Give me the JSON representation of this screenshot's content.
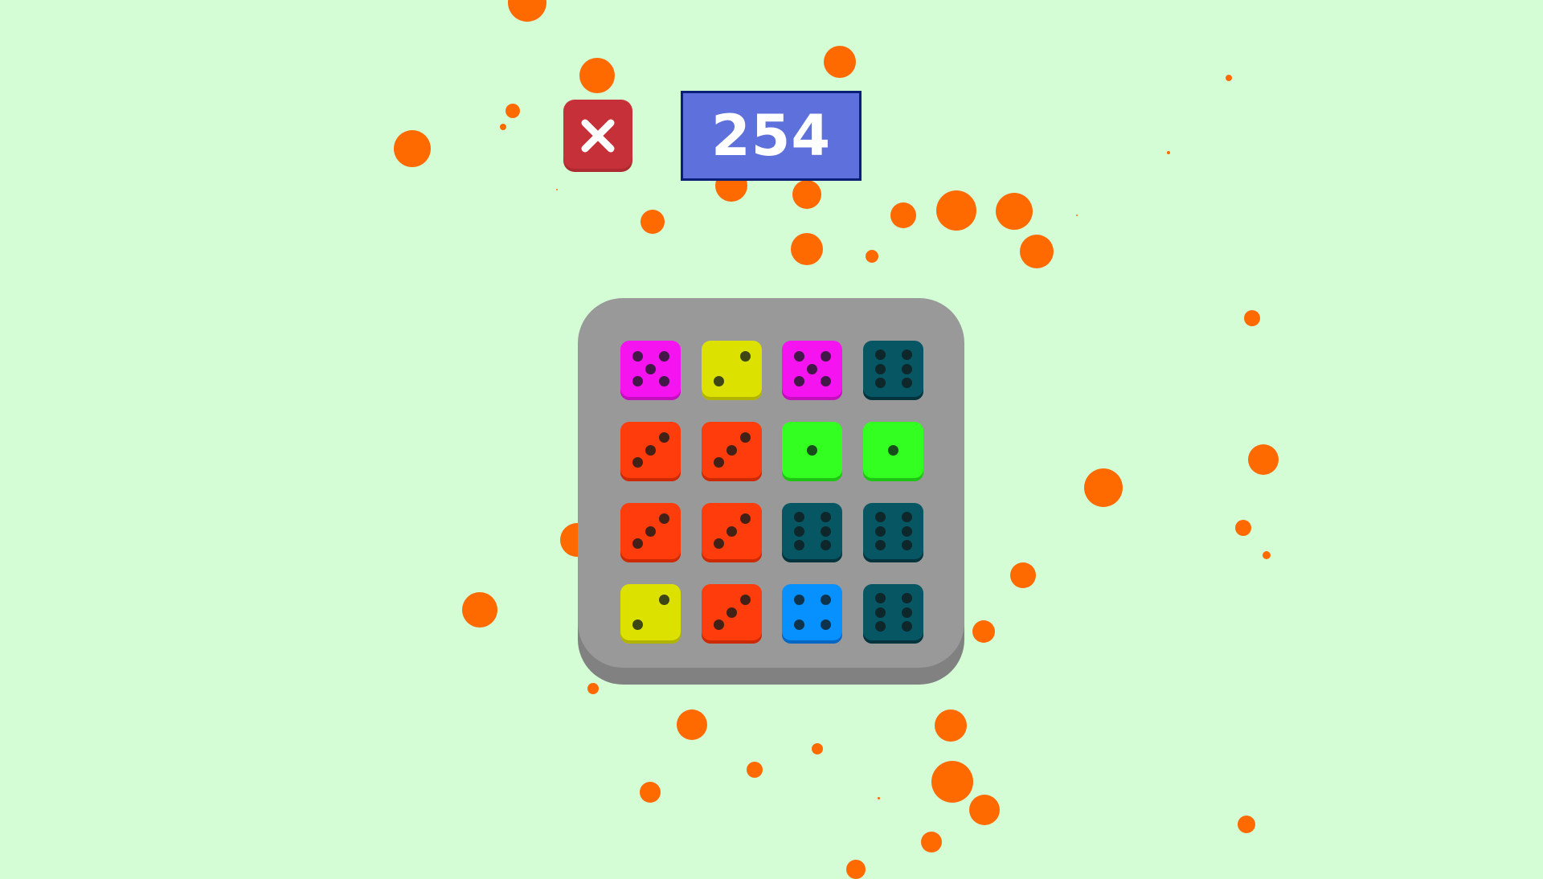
{
  "score": {
    "value": "254"
  },
  "close_button": {
    "icon": "close-icon"
  },
  "colors": {
    "background": "#d4fdd6",
    "particle": "#ff6a00",
    "board": "#999999",
    "board_shadow": "#818181",
    "score_bg": "#5d70dc",
    "score_border": "#0a1f78",
    "close_bg": "#c63038"
  },
  "board": {
    "rows": 4,
    "cols": 4,
    "dice": [
      {
        "value": 5,
        "color": "#f514ef",
        "shade": "#c40fbf"
      },
      {
        "value": 2,
        "color": "#dde100",
        "shade": "#b0b300"
      },
      {
        "value": 5,
        "color": "#f514ef",
        "shade": "#c40fbf"
      },
      {
        "value": 6,
        "color": "#075664",
        "shade": "#03343d"
      },
      {
        "value": 3,
        "color": "#ff3c0b",
        "shade": "#cc2a04"
      },
      {
        "value": 3,
        "color": "#ff3c0b",
        "shade": "#cc2a04"
      },
      {
        "value": 1,
        "color": "#33ff21",
        "shade": "#1fc313"
      },
      {
        "value": 1,
        "color": "#33ff21",
        "shade": "#1fc313"
      },
      {
        "value": 3,
        "color": "#ff3c0b",
        "shade": "#cc2a04"
      },
      {
        "value": 3,
        "color": "#ff3c0b",
        "shade": "#cc2a04"
      },
      {
        "value": 6,
        "color": "#075664",
        "shade": "#03343d"
      },
      {
        "value": 6,
        "color": "#075664",
        "shade": "#03343d"
      },
      {
        "value": 2,
        "color": "#dde100",
        "shade": "#b0b300"
      },
      {
        "value": 3,
        "color": "#ff3c0b",
        "shade": "#cc2a04"
      },
      {
        "value": 4,
        "color": "#0790ff",
        "shade": "#0567c4"
      },
      {
        "value": 6,
        "color": "#075664",
        "shade": "#03343d"
      }
    ]
  }
}
